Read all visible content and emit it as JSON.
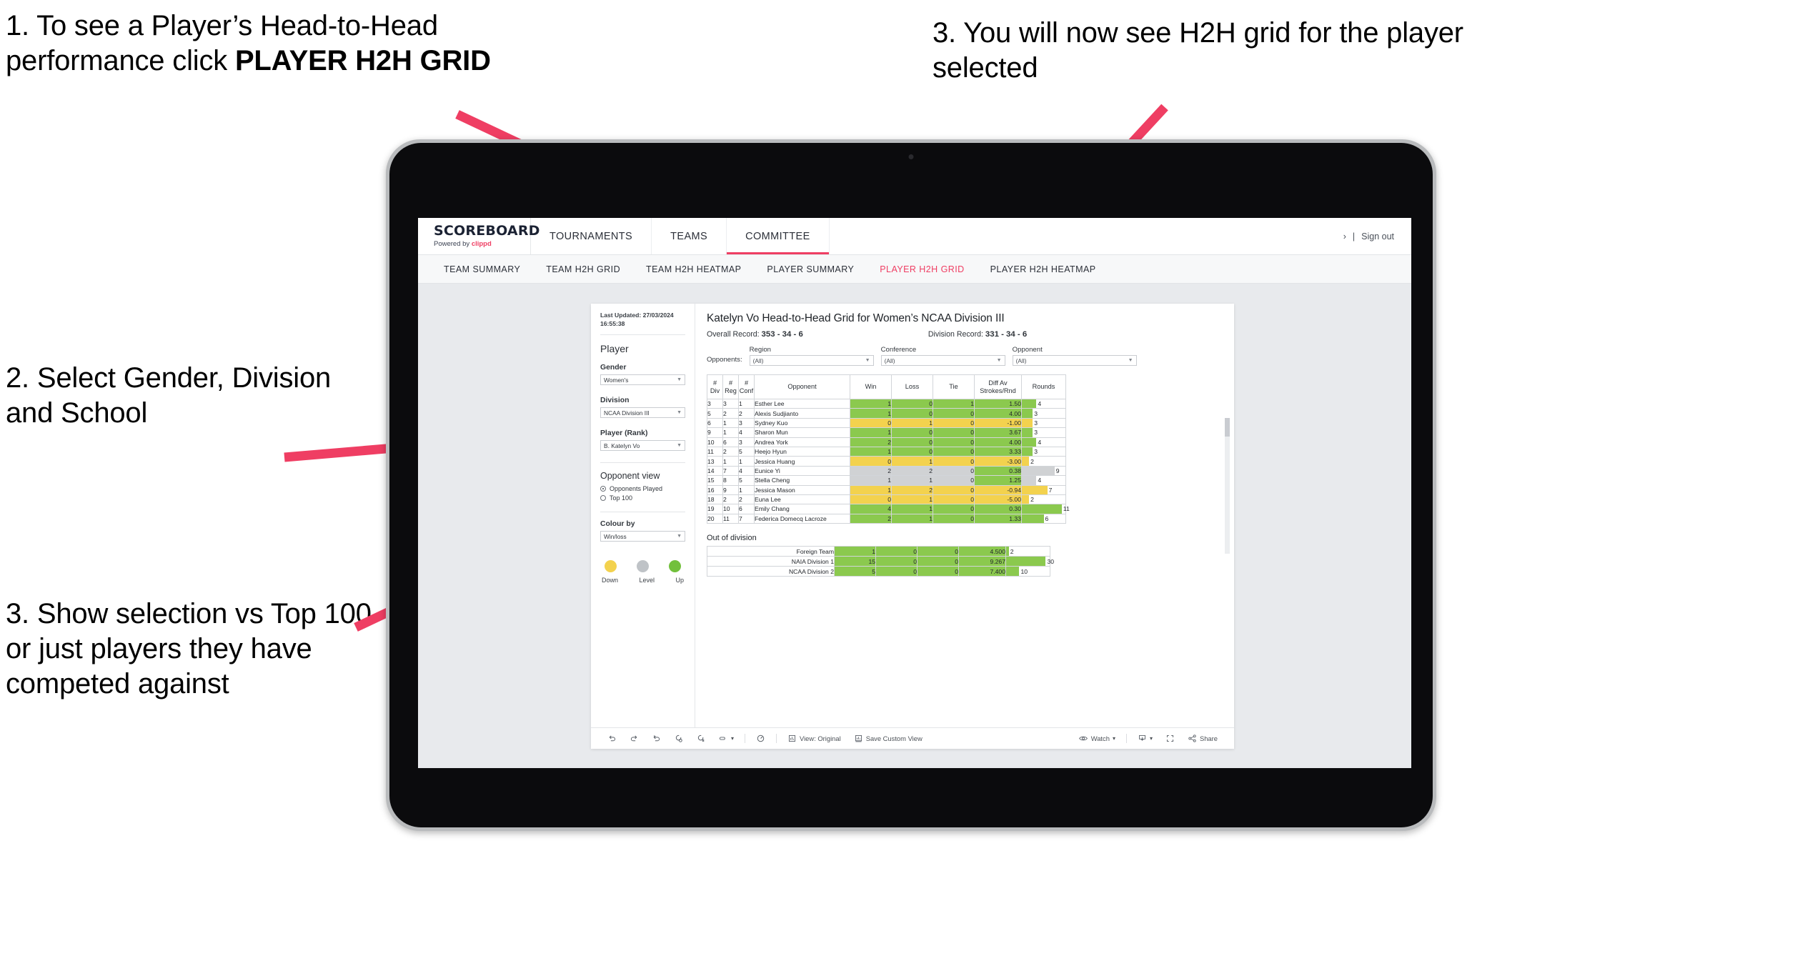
{
  "annotations": {
    "step1_a": "1. To see a Player’s Head-to-Head performance click ",
    "step1_b": "PLAYER H2H GRID",
    "step2": "2. Select Gender, Division and School",
    "step3_left": "3. Show selection vs Top 100 or just players they have competed against",
    "step3_right": "3. You will now see H2H grid for the player selected"
  },
  "app": {
    "brand": {
      "name": "SCOREBOARD",
      "powered_prefix": "Powered by ",
      "powered_brand": "clippd"
    },
    "topnav": [
      "TOURNAMENTS",
      "TEAMS",
      "COMMITTEE"
    ],
    "topnav_active": "COMMITTEE",
    "account": {
      "chevron": "›",
      "divider": "|",
      "sign_out": "Sign out"
    },
    "subnav": [
      "TEAM SUMMARY",
      "TEAM H2H GRID",
      "TEAM H2H HEATMAP",
      "PLAYER SUMMARY",
      "PLAYER H2H GRID",
      "PLAYER H2H HEATMAP"
    ],
    "subnav_active": "PLAYER H2H GRID"
  },
  "sidebar": {
    "last_updated": "Last Updated: 27/03/2024 16:55:38",
    "section_player": "Player",
    "gender": {
      "label": "Gender",
      "value": "Women's"
    },
    "division": {
      "label": "Division",
      "value": "NCAA Division III"
    },
    "player_rank": {
      "label": "Player (Rank)",
      "value": "B. Katelyn Vo"
    },
    "opponent_view": {
      "label": "Opponent view",
      "options": [
        "Opponents Played",
        "Top 100"
      ],
      "selected": "Opponents Played"
    },
    "colour_by": {
      "label": "Colour by",
      "value": "Win/loss"
    },
    "legend": [
      {
        "name": "Down",
        "color": "#f3d24e"
      },
      {
        "name": "Level",
        "color": "#bfc3c7"
      },
      {
        "name": "Up",
        "color": "#8bc94e"
      }
    ]
  },
  "main": {
    "title": "Katelyn Vo Head-to-Head Grid for Women’s NCAA Division III",
    "overall_record_label": "Overall Record:",
    "overall_record_value": "353 - 34 - 6",
    "division_record_label": "Division Record:",
    "division_record_value": "331 - 34 - 6",
    "opponents_label": "Opponents:",
    "filters": [
      {
        "name": "Region",
        "value": "(All)"
      },
      {
        "name": "Conference",
        "value": "(All)"
      },
      {
        "name": "Opponent",
        "value": "(All)"
      }
    ],
    "columns": [
      "# Div",
      "# Reg",
      "# Conf",
      "Opponent",
      "Win",
      "Loss",
      "Tie",
      "Diff Av Strokes/Rnd",
      "Rounds"
    ],
    "out_of_division_title": "Out of division"
  },
  "chart_data": {
    "type": "table",
    "title": "Katelyn Vo Head-to-Head Grid for Women’s NCAA Division III",
    "columns": [
      "#Div",
      "#Reg",
      "#Conf",
      "Opponent",
      "Win",
      "Loss",
      "Tie",
      "Diff Av Strokes/Rnd",
      "Rounds"
    ],
    "rounds_max": 12,
    "colors": {
      "up": "#8bc94e",
      "down": "#f3d24e",
      "level": "#d0d2d4"
    },
    "rows": [
      {
        "div": "3",
        "reg": "3",
        "conf": "1",
        "opponent": "Esther Lee",
        "win": "1",
        "loss": "0",
        "tie": "1",
        "diff": "1.50",
        "rounds": "4",
        "state": "up"
      },
      {
        "div": "5",
        "reg": "2",
        "conf": "2",
        "opponent": "Alexis Sudjianto",
        "win": "1",
        "loss": "0",
        "tie": "0",
        "diff": "4.00",
        "rounds": "3",
        "state": "up"
      },
      {
        "div": "6",
        "reg": "1",
        "conf": "3",
        "opponent": "Sydney Kuo",
        "win": "0",
        "loss": "1",
        "tie": "0",
        "diff": "-1.00",
        "rounds": "3",
        "state": "down"
      },
      {
        "div": "9",
        "reg": "1",
        "conf": "4",
        "opponent": "Sharon Mun",
        "win": "1",
        "loss": "0",
        "tie": "0",
        "diff": "3.67",
        "rounds": "3",
        "state": "up"
      },
      {
        "div": "10",
        "reg": "6",
        "conf": "3",
        "opponent": "Andrea York",
        "win": "2",
        "loss": "0",
        "tie": "0",
        "diff": "4.00",
        "rounds": "4",
        "state": "up"
      },
      {
        "div": "11",
        "reg": "2",
        "conf": "5",
        "opponent": "Heejo Hyun",
        "win": "1",
        "loss": "0",
        "tie": "0",
        "diff": "3.33",
        "rounds": "3",
        "state": "up"
      },
      {
        "div": "13",
        "reg": "1",
        "conf": "1",
        "opponent": "Jessica Huang",
        "win": "0",
        "loss": "1",
        "tie": "0",
        "diff": "-3.00",
        "rounds": "2",
        "state": "down"
      },
      {
        "div": "14",
        "reg": "7",
        "conf": "4",
        "opponent": "Eunice Yi",
        "win": "2",
        "loss": "2",
        "tie": "0",
        "diff": "0.38",
        "rounds": "9",
        "state": "level",
        "diff_state": "up"
      },
      {
        "div": "15",
        "reg": "8",
        "conf": "5",
        "opponent": "Stella Cheng",
        "win": "1",
        "loss": "1",
        "tie": "0",
        "diff": "1.25",
        "rounds": "4",
        "state": "level",
        "diff_state": "up"
      },
      {
        "div": "16",
        "reg": "9",
        "conf": "1",
        "opponent": "Jessica Mason",
        "win": "1",
        "loss": "2",
        "tie": "0",
        "diff": "-0.94",
        "rounds": "7",
        "state": "down"
      },
      {
        "div": "18",
        "reg": "2",
        "conf": "2",
        "opponent": "Euna Lee",
        "win": "0",
        "loss": "1",
        "tie": "0",
        "diff": "-5.00",
        "rounds": "2",
        "state": "down"
      },
      {
        "div": "19",
        "reg": "10",
        "conf": "6",
        "opponent": "Emily Chang",
        "win": "4",
        "loss": "1",
        "tie": "0",
        "diff": "0.30",
        "rounds": "11",
        "state": "up"
      },
      {
        "div": "20",
        "reg": "11",
        "conf": "7",
        "opponent": "Federica Domecq Lacroze",
        "win": "2",
        "loss": "1",
        "tie": "0",
        "diff": "1.33",
        "rounds": "6",
        "state": "up"
      }
    ],
    "out_of_division": [
      {
        "name": "Foreign Team",
        "win": "1",
        "loss": "0",
        "tie": "0",
        "diff": "4.500",
        "rounds": "2",
        "state": "up"
      },
      {
        "name": "NAIA Division 1",
        "win": "15",
        "loss": "0",
        "tie": "0",
        "diff": "9.267",
        "rounds": "30",
        "state": "up"
      },
      {
        "name": "NCAA Division 2",
        "win": "5",
        "loss": "0",
        "tie": "0",
        "diff": "7.400",
        "rounds": "10",
        "state": "up"
      }
    ],
    "out_of_division_rounds_max": 33
  },
  "toolbar": {
    "view_label": "View: Original",
    "save_label": "Save Custom View",
    "watch_label": "Watch",
    "share_label": "Share",
    "caret": "▾"
  }
}
